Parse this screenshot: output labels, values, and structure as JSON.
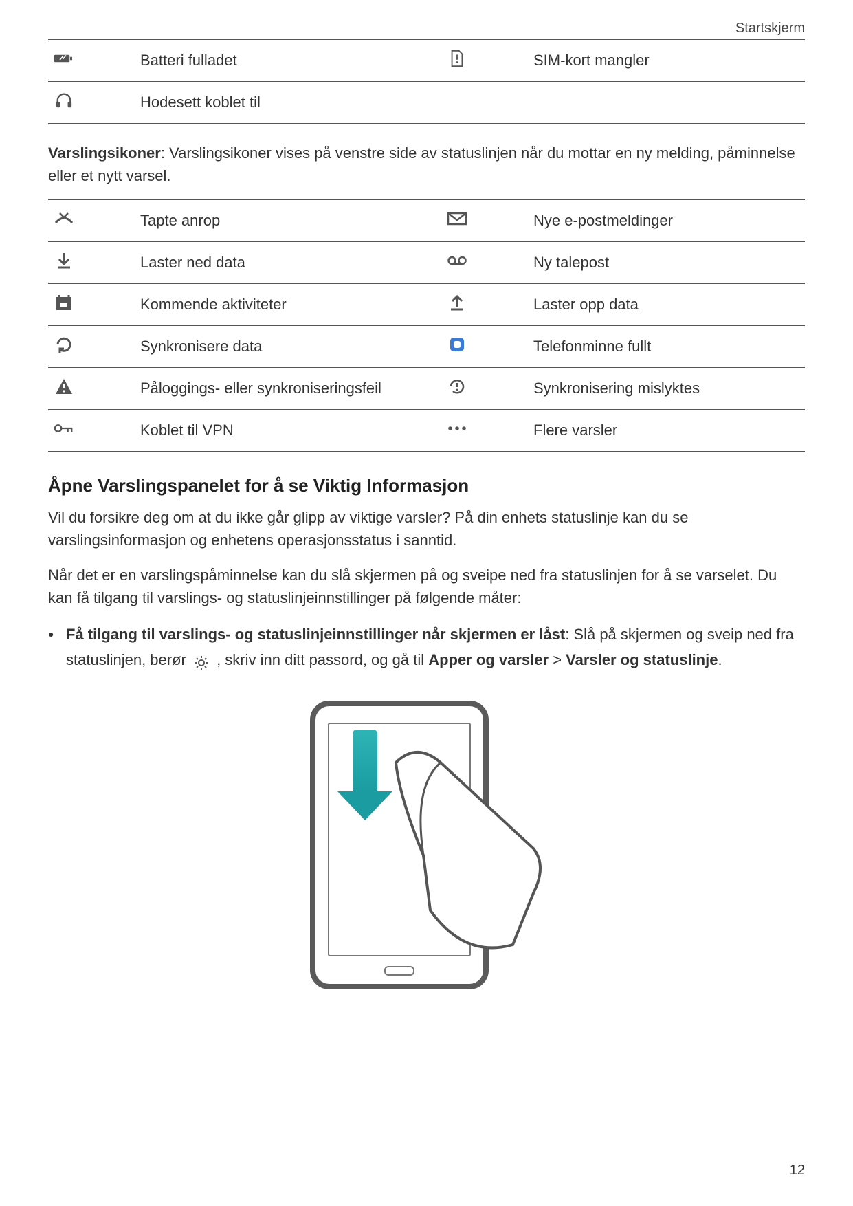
{
  "header": {
    "breadcrumb": "Startskjerm"
  },
  "status_table": {
    "rows": [
      {
        "icon": "battery-full-icon",
        "label": "Batteri fulladet",
        "icon2": "sim-missing-icon",
        "label2": "SIM-kort mangler"
      },
      {
        "icon": "headset-icon",
        "label": "Hodesett koblet til",
        "icon2": "",
        "label2": ""
      }
    ]
  },
  "intro": {
    "bold_lead": "Varslingsikoner",
    "rest": ": Varslingsikoner vises på venstre side av statuslinjen når du mottar en ny melding, påminnelse eller et nytt varsel."
  },
  "notification_table": {
    "rows": [
      {
        "icon": "missed-call-icon",
        "label": "Tapte anrop",
        "icon2": "mail-icon",
        "label2": "Nye e-postmeldinger"
      },
      {
        "icon": "download-icon",
        "label": "Laster ned data",
        "icon2": "voicemail-icon",
        "label2": "Ny talepost"
      },
      {
        "icon": "calendar-icon",
        "label": "Kommende aktiviteter",
        "icon2": "upload-icon",
        "label2": "Laster opp data"
      },
      {
        "icon": "sync-icon",
        "label": "Synkronisere data",
        "icon2": "memory-full-icon",
        "label2": "Telefonminne fullt"
      },
      {
        "icon": "warning-icon",
        "label": "Påloggings- eller synkroniseringsfeil",
        "icon2": "sync-failed-icon",
        "label2": "Synkronisering mislyktes"
      },
      {
        "icon": "vpn-icon",
        "label": "Koblet til VPN",
        "icon2": "more-icon",
        "label2": "Flere varsler"
      }
    ]
  },
  "section": {
    "heading": "Åpne Varslingspanelet for å se Viktig Informasjon",
    "p1": "Vil du forsikre deg om at du ikke går glipp av viktige varsler? På din enhets statuslinje kan du se varslingsinformasjon og enhetens operasjonsstatus i sanntid.",
    "p2": "Når det er en varslingspåminnelse kan du slå skjermen på og sveipe ned fra statuslinjen for å se varselet. Du kan få tilgang til varslings- og statuslinjeinnstillinger på følgende måter:",
    "bullet_lead_bold": "Få tilgang til varslings- og statuslinjeinnstillinger når skjermen er låst",
    "bullet_tail1": ": Slå på skjermen og sveip ned fra statuslinjen, berør ",
    "bullet_tail2": " , skriv inn ditt passord, og gå til ",
    "path_bold1": "Apper og varsler",
    "path_sep": " > ",
    "path_bold2": "Varsler og statuslinje",
    "path_end": "."
  },
  "page_number": "12"
}
